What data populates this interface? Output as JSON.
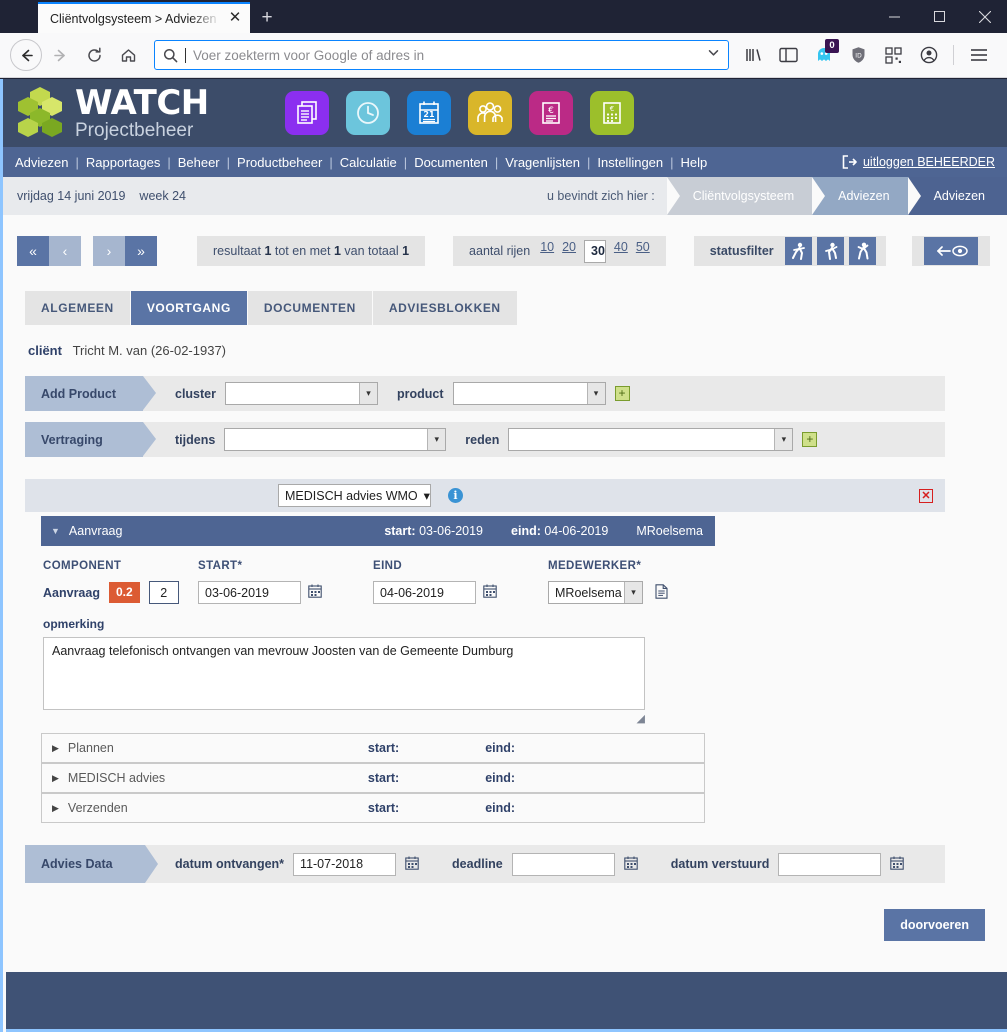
{
  "browser": {
    "tab_title": "Cliëntvolgsysteem > Adviezen > Ad",
    "tab_close_icon": "close-icon",
    "new_tab_icon": "plus-icon",
    "back_icon": "arrow-left-icon",
    "forward_icon": "arrow-right-icon",
    "reload_icon": "reload-icon",
    "home_icon": "home-icon",
    "search_icon": "search-icon",
    "url_placeholder": "Voer zoekterm voor Google of adres in",
    "url_value": "",
    "toolbar_icons": [
      {
        "name": "library-icon",
        "glyph": "|||\\"
      },
      {
        "name": "sidebar-icon",
        "glyph": "▣"
      },
      {
        "name": "ghost-privacy-icon",
        "glyph": "👻",
        "badge": "0"
      },
      {
        "name": "shield-icon",
        "glyph": "🛡"
      },
      {
        "name": "qr-container-icon",
        "glyph": "▦"
      },
      {
        "name": "account-icon",
        "glyph": "◉"
      },
      {
        "name": "menu-icon",
        "glyph": "☰"
      }
    ],
    "window_minimize": "—",
    "window_maximize": "☐",
    "window_close": "✕"
  },
  "app": {
    "logo_title": "WATCH",
    "logo_subtitle": "Projectbeheer",
    "app_icons": [
      {
        "name": "documents-app-icon",
        "color": "#8b2ff0",
        "glyph": "🗐"
      },
      {
        "name": "clock-app-icon",
        "color": "#6cc5dc",
        "glyph": "◷"
      },
      {
        "name": "calendar-app-icon",
        "color": "#1b7fd4",
        "glyph": "21"
      },
      {
        "name": "people-app-icon",
        "color": "#d9b62a",
        "glyph": "👥"
      },
      {
        "name": "invoice-euro-app-icon",
        "color": "#bb2a86",
        "glyph": "€"
      },
      {
        "name": "calculator-app-icon",
        "color": "#9cbf2b",
        "glyph": "€"
      }
    ],
    "nav": [
      "Adviezen",
      "Rapportages",
      "Beheer",
      "Productbeheer",
      "Calculatie",
      "Documenten",
      "Vragenlijsten",
      "Instellingen",
      "Help"
    ],
    "logout_icon": "logout-icon",
    "logout_label": "uitloggen BEHEERDER"
  },
  "crumbbar": {
    "date": "vrijdag 14 juni 2019",
    "week": "week 24",
    "here_label": "u bevindt zich hier :",
    "crumbs": [
      "Cliëntvolgsysteem",
      "Adviezen",
      "Adviezen"
    ]
  },
  "toolbar": {
    "pager": [
      {
        "name": "first-page-button",
        "glyph": "«",
        "style": "dark"
      },
      {
        "name": "prev-page-button",
        "glyph": "‹",
        "style": "light"
      },
      {
        "name": "next-page-button",
        "glyph": "›",
        "style": "light"
      },
      {
        "name": "last-page-button",
        "glyph": "»",
        "style": "dark"
      }
    ],
    "result_prefix": "resultaat",
    "result_from": "1",
    "result_mid": "tot en met",
    "result_to": "1",
    "result_of": "van totaal",
    "result_total": "1",
    "rows_label": "aantal rijen",
    "rows_options": [
      "10",
      "20",
      "30",
      "40",
      "50"
    ],
    "rows_selected": "30",
    "statusfilter_label": "statusfilter",
    "status_icons": [
      "walking-figure-icon",
      "running-figure-icon",
      "sprinting-figure-icon"
    ],
    "eye_button": "back-eye-icon"
  },
  "tabs": [
    {
      "label": "ALGEMEEN",
      "active": false
    },
    {
      "label": "VOORTGANG",
      "active": true
    },
    {
      "label": "DOCUMENTEN",
      "active": false
    },
    {
      "label": "ADVIESBLOKKEN",
      "active": false
    }
  ],
  "client": {
    "label": "cliënt",
    "value": "Tricht M. van (26-02-1937)"
  },
  "add_product": {
    "label": "Add Product",
    "cluster_label": "cluster",
    "cluster_value": "",
    "product_label": "product",
    "product_value": "",
    "add_icon": "plus-square-icon"
  },
  "vertraging": {
    "label": "Vertraging",
    "tijdens_label": "tijdens",
    "tijdens_value": "",
    "reden_label": "reden",
    "reden_value": "",
    "add_icon": "plus-square-icon"
  },
  "product_row": {
    "selected_product": "MEDISCH advies WMO",
    "info_icon": "info-icon",
    "delete_icon": "delete-icon"
  },
  "accordion_open": {
    "title": "Aanvraag",
    "start_label": "start:",
    "start_value": "03-06-2019",
    "eind_label": "eind:",
    "eind_value": "04-06-2019",
    "employee": "MRoelsema",
    "collapse_icon": "triangle-down-icon"
  },
  "detail": {
    "headers": [
      "COMPONENT",
      "START*",
      "EIND",
      "MEDEWERKER*"
    ],
    "component_name": "Aanvraag",
    "hours_chip": "0.2",
    "count_value": "2",
    "start_value": "03-06-2019",
    "eind_value": "04-06-2019",
    "medewerker_value": "MRoelsema",
    "calendar_icon": "calendar-icon",
    "document_icon": "document-icon",
    "opmerking_label": "opmerking",
    "opmerking_value": "Aanvraag telefonisch ontvangen van mevrouw Joosten van de Gemeente Dumburg",
    "resize_icon": "resize-handle-icon"
  },
  "collapsed_rows": [
    {
      "label": "Plannen",
      "start_label": "start:",
      "start_value": "",
      "eind_label": "eind:",
      "eind_value": "",
      "expand_icon": "triangle-right-icon"
    },
    {
      "label": "MEDISCH advies",
      "start_label": "start:",
      "start_value": "",
      "eind_label": "eind:",
      "eind_value": "",
      "expand_icon": "triangle-right-icon"
    },
    {
      "label": "Verzenden",
      "start_label": "start:",
      "start_value": "",
      "eind_label": "eind:",
      "eind_value": "",
      "expand_icon": "triangle-right-icon"
    }
  ],
  "advies_data": {
    "label": "Advies Data",
    "ontvangen_label": "datum ontvangen*",
    "ontvangen_value": "11-07-2018",
    "deadline_label": "deadline",
    "deadline_value": "",
    "verstuurd_label": "datum verstuurd",
    "verstuurd_value": "",
    "calendar_icon": "calendar-icon"
  },
  "submit": {
    "label": "doorvoeren"
  },
  "colors": {
    "header_bg": "#3c4c69",
    "nav_bg": "#4e6593",
    "accent": "#5a74a5",
    "chip_orange": "#dc5b33",
    "footer": "#3f5275",
    "page_border": "#8ec5ff"
  }
}
